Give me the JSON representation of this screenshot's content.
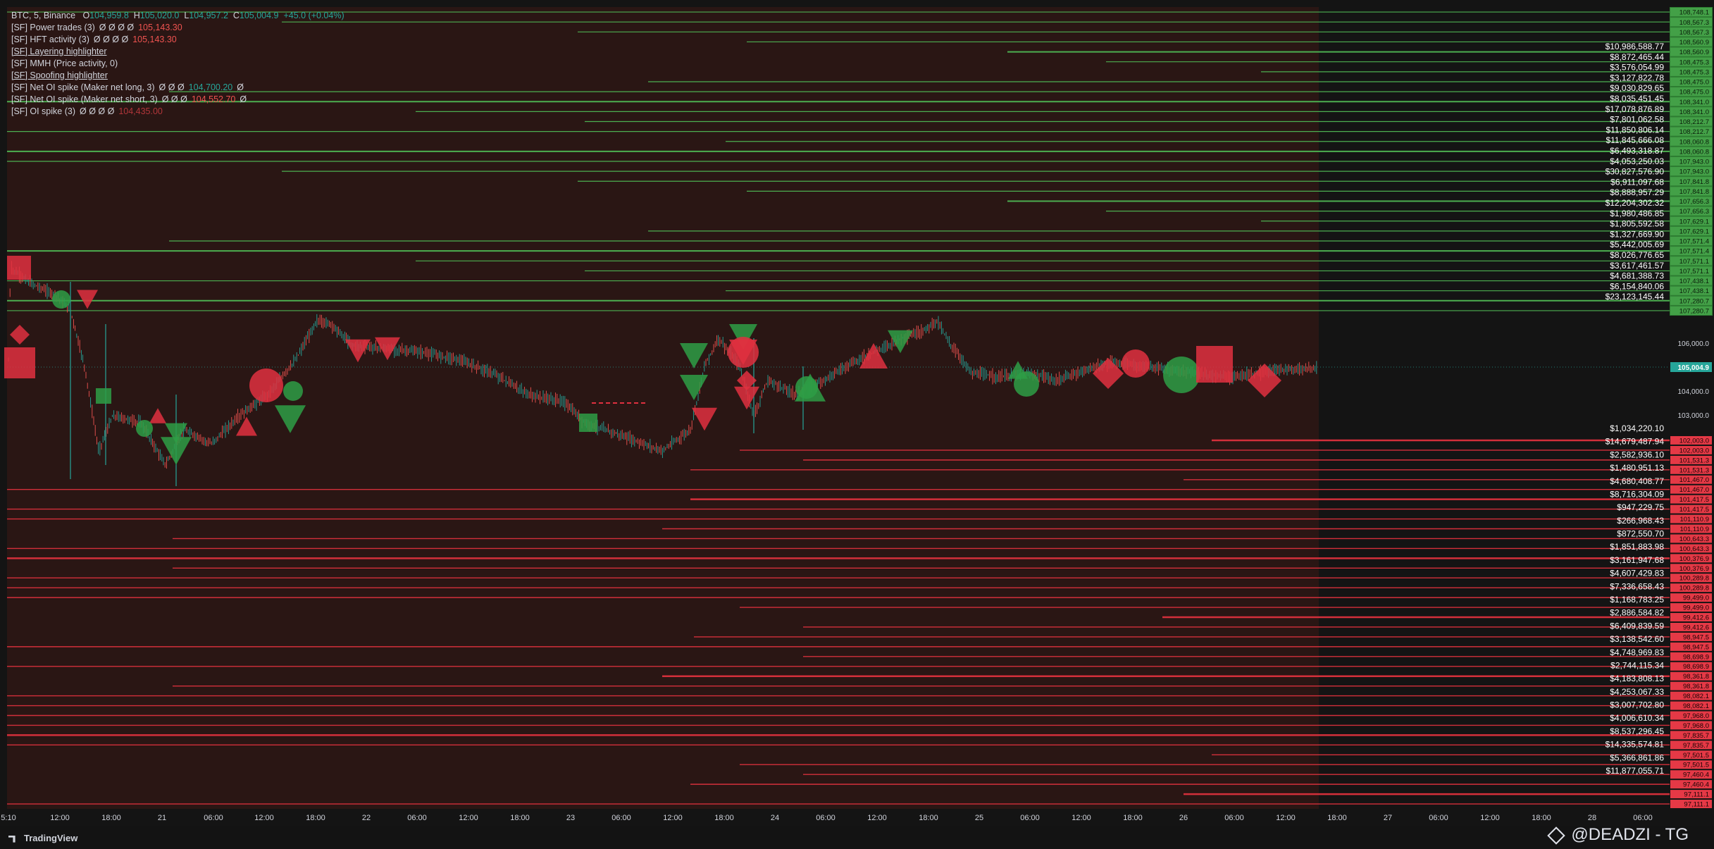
{
  "legend": {
    "symbol": "BTC, 5, Binance",
    "o_label": "O",
    "o_value": "104,959.8",
    "h_label": "H",
    "h_value": "105,020.0",
    "l_label": "L",
    "l_value": "104,957.2",
    "c_label": "C",
    "c_value": "105,004.9",
    "change": "+45.0 (+0.04%)",
    "indicators": [
      {
        "name": "[SF] Power trades (3)",
        "values": "Ø Ø Ø Ø",
        "extra": "105,143.30",
        "extra_color": "#ef5350"
      },
      {
        "name": "[SF] HFT activity (3)",
        "values": "Ø Ø Ø Ø",
        "extra": "105,143.30",
        "extra_color": "#ef5350"
      },
      {
        "name": "[SF] Layering highlighter",
        "values": "",
        "extra": "",
        "extra_color": "#d1d4dc"
      },
      {
        "name": "[SF] MMH (Price activity, 0)",
        "values": "",
        "extra": "",
        "extra_color": "#d1d4dc"
      },
      {
        "name": "[SF] Spoofing highlighter",
        "values": "",
        "extra": "",
        "extra_color": "#d1d4dc"
      },
      {
        "name": "[SF] Net OI spike (Maker net long, 3)",
        "values": "Ø Ø Ø",
        "extra": "104,700.20",
        "extra_color": "#26a69a",
        "tail": "Ø"
      },
      {
        "name": "[SF] Net OI spike (Maker net short, 3)",
        "values": "Ø Ø Ø",
        "extra": "104,552.70",
        "extra_color": "#ef5350",
        "tail": "Ø"
      },
      {
        "name": "[SF] OI spike (3)",
        "values": "Ø Ø Ø Ø",
        "extra": "104,435.00",
        "extra_color": "#b2363a"
      }
    ]
  },
  "colors": {
    "background": "#141414",
    "history_bg": "#2a1614",
    "bull": "#26a69a",
    "bull_line": "#4caf50",
    "bear": "#f23645",
    "bear_line": "#d32f3a",
    "axis_text": "#d1d4dc"
  },
  "price_axis": {
    "current_price": "105,004.9",
    "green_labels": [
      "108,748.1",
      "108,567.3",
      "108,567.3",
      "108,560.9",
      "108,560.9",
      "108,475.3",
      "108,475.3",
      "108,475.0",
      "108,475.0",
      "108,341.0",
      "108,341.0",
      "108,212.7",
      "108,212.7",
      "108,060.8",
      "108,060.8",
      "107,943.0",
      "107,943.0",
      "107,841.8",
      "107,841.8",
      "107,656.3",
      "107,656.3",
      "107,629.1",
      "107,629.1",
      "107,571.4",
      "107,571.4",
      "107,571.1",
      "107,571.1",
      "107,438.1",
      "107,438.1",
      "107,280.7",
      "107,280.7"
    ],
    "plain_labels": [
      "106,000.0",
      "104,000.0",
      "103,000.0"
    ],
    "red_labels": [
      "102,003.0",
      "102,003.0",
      "101,531.3",
      "101,531.3",
      "101,467.0",
      "101,467.0",
      "101,417.5",
      "101,417.5",
      "101,110.9",
      "101,110.9",
      "100,643.3",
      "100,643.3",
      "100,376.9",
      "100,376.9",
      "100,289.8",
      "100,289.8",
      "99,499.0",
      "99,499.0",
      "99,412.6",
      "99,412.6",
      "98,947.5",
      "98,947.5",
      "98,698.9",
      "98,698.9",
      "98,361.8",
      "98,361.8",
      "98,082.1",
      "98,082.1",
      "97,968.0",
      "97,968.0",
      "97,835.7",
      "97,835.7",
      "97,501.5",
      "97,501.5",
      "97,460.4",
      "97,460.4",
      "97,111.1",
      "97,111.1"
    ]
  },
  "volume_labels": {
    "upper": [
      "$10,986,588.77",
      "$8,872,465.44",
      "$3,576,054.99",
      "$3,127,822.78",
      "$9,030,829.65",
      "$8,035,451.45",
      "$17,078,876.89",
      "$7,801,062.58",
      "$11,850,806.14",
      "$11,845,666.08",
      "$6,493,318.87",
      "$4,053,250.03",
      "$30,827,576.90",
      "$6,911,097.68",
      "$8,888,957.29",
      "$12,204,302.32",
      "$1,980,486.85",
      "$1,805,592.58",
      "$1,327,669.90",
      "$5,442,005.69",
      "$8,026,776.65",
      "$3,617,461.57",
      "$4,681,388.73",
      "$6,154,840.06",
      "$23,123,145.44"
    ],
    "lower": [
      "$1,034,220.10",
      "$14,679,487.94",
      "$2,582,936.10",
      "$1,480,951.13",
      "$4,680,408.77",
      "$8,716,304.09",
      "$947,229.75",
      "$266,968.43",
      "$872,550.70",
      "$1,851,883.98",
      "$3,161,947.68",
      "$4,607,429.83",
      "$7,336,658.43",
      "$1,168,783.25",
      "$2,886,584.82",
      "$6,409,839.59",
      "$3,138,542.60",
      "$4,748,969.83",
      "$2,744,115.34",
      "$4,183,808.13",
      "$4,253,067.33",
      "$3,007,702.80",
      "$4,006,610.34",
      "$8,537,296.45",
      "$14,335,574.81",
      "$5,366,861.86",
      "$11,877,055.71"
    ]
  },
  "time_axis": {
    "labels": [
      "5:10",
      "12:00",
      "18:00",
      "21",
      "06:00",
      "12:00",
      "18:00",
      "22",
      "06:00",
      "12:00",
      "18:00",
      "23",
      "06:00",
      "12:00",
      "18:00",
      "24",
      "06:00",
      "12:00",
      "18:00",
      "25",
      "06:00",
      "12:00",
      "18:00",
      "26",
      "06:00",
      "12:00",
      "18:00",
      "27",
      "06:00",
      "12:00",
      "18:00",
      "28",
      "06:00"
    ]
  },
  "branding": {
    "logo_text": "TradingView",
    "watermark": "@DEADZI - TG"
  }
}
